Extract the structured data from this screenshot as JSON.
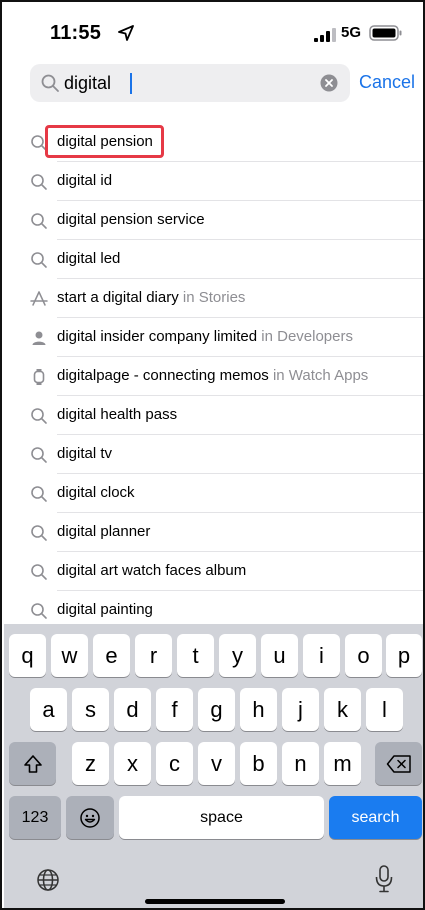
{
  "status_bar": {
    "time": "11:55",
    "network": "5G"
  },
  "search": {
    "query": "digital",
    "cancel_label": "Cancel"
  },
  "suggestions": [
    {
      "text": "digital pension",
      "suffix": "",
      "icon": "search-icon"
    },
    {
      "text": "digital id",
      "suffix": "",
      "icon": "search-icon"
    },
    {
      "text": "digital pension service",
      "suffix": "",
      "icon": "search-icon"
    },
    {
      "text": "digital led",
      "suffix": "",
      "icon": "search-icon"
    },
    {
      "text": "start a digital diary",
      "suffix": "in Stories",
      "icon": "stories-icon"
    },
    {
      "text": "digital insider company limited",
      "suffix": "in Developers",
      "icon": "developer-person-icon"
    },
    {
      "text": "digitalpage - connecting memos",
      "suffix": "in Watch Apps",
      "icon": "watch-icon"
    },
    {
      "text": "digital health pass",
      "suffix": "",
      "icon": "search-icon"
    },
    {
      "text": "digital tv",
      "suffix": "",
      "icon": "search-icon"
    },
    {
      "text": "digital clock",
      "suffix": "",
      "icon": "search-icon"
    },
    {
      "text": "digital planner",
      "suffix": "",
      "icon": "search-icon"
    },
    {
      "text": "digital art watch faces album",
      "suffix": "",
      "icon": "search-icon"
    },
    {
      "text": "digital painting",
      "suffix": "",
      "icon": "search-icon"
    }
  ],
  "keyboard": {
    "row1": [
      "q",
      "w",
      "e",
      "r",
      "t",
      "y",
      "u",
      "i",
      "o",
      "p"
    ],
    "row2": [
      "a",
      "s",
      "d",
      "f",
      "g",
      "h",
      "j",
      "k",
      "l"
    ],
    "row3": [
      "z",
      "x",
      "c",
      "v",
      "b",
      "n",
      "m"
    ],
    "numbers_label": "123",
    "space_label": "space",
    "search_label": "search"
  },
  "colors": {
    "accent": "#1a73e8",
    "highlight": "#e63946",
    "keyboard_bg": "#d1d3d9"
  }
}
